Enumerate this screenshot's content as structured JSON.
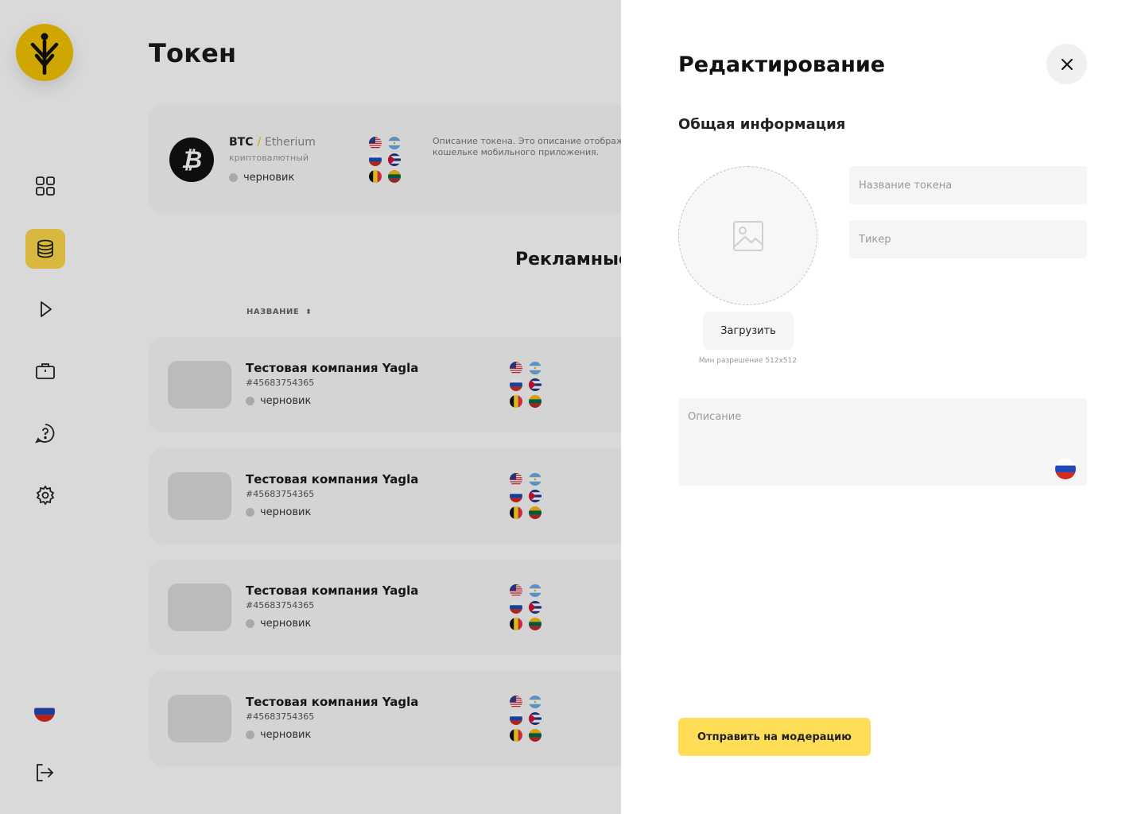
{
  "sidebar": {
    "items": [
      {
        "icon": "dashboard-icon",
        "active": false
      },
      {
        "icon": "database-icon",
        "active": true
      },
      {
        "icon": "play-icon",
        "active": false
      },
      {
        "icon": "briefcase-icon",
        "active": false
      },
      {
        "icon": "help-icon",
        "active": false
      },
      {
        "icon": "settings-icon",
        "active": false
      }
    ],
    "language_flag": "flag-ru",
    "logout_icon": "logout-icon"
  },
  "page": {
    "title": "Токен"
  },
  "token": {
    "symbol": "BTC",
    "separator": "/",
    "network": "Etherium",
    "type": "криптовалютный",
    "status": "черновик",
    "description": "Описание токена. Это описание отобража кошельке мобильного приложения."
  },
  "campaigns_section": {
    "title": "Рекламные",
    "column_name": "НАЗВАНИЕ"
  },
  "campaigns": [
    {
      "title": "Тестовая компания Yagla",
      "id": "#45683754365",
      "status": "черновик"
    },
    {
      "title": "Тестовая компания Yagla",
      "id": "#45683754365",
      "status": "черновик"
    },
    {
      "title": "Тестовая компания Yagla",
      "id": "#45683754365",
      "status": "черновик"
    },
    {
      "title": "Тестовая компания Yagla",
      "id": "#45683754365",
      "status": "черновик"
    }
  ],
  "drawer": {
    "title": "Редактирование",
    "section_title": "Общая информация",
    "upload_button": "Загрузить",
    "upload_hint": "Мин разрешение 512х512",
    "token_name_placeholder": "Название токена",
    "ticker_placeholder": "Тикер",
    "description_placeholder": "Описание",
    "description_language": "flag-ru",
    "submit_button": "Отправить на модерацию"
  },
  "colors": {
    "accent": "#ffdd57",
    "logo": "#f5c400",
    "active_nav": "#ffd94a",
    "status_dot": "#c7c7c7"
  }
}
